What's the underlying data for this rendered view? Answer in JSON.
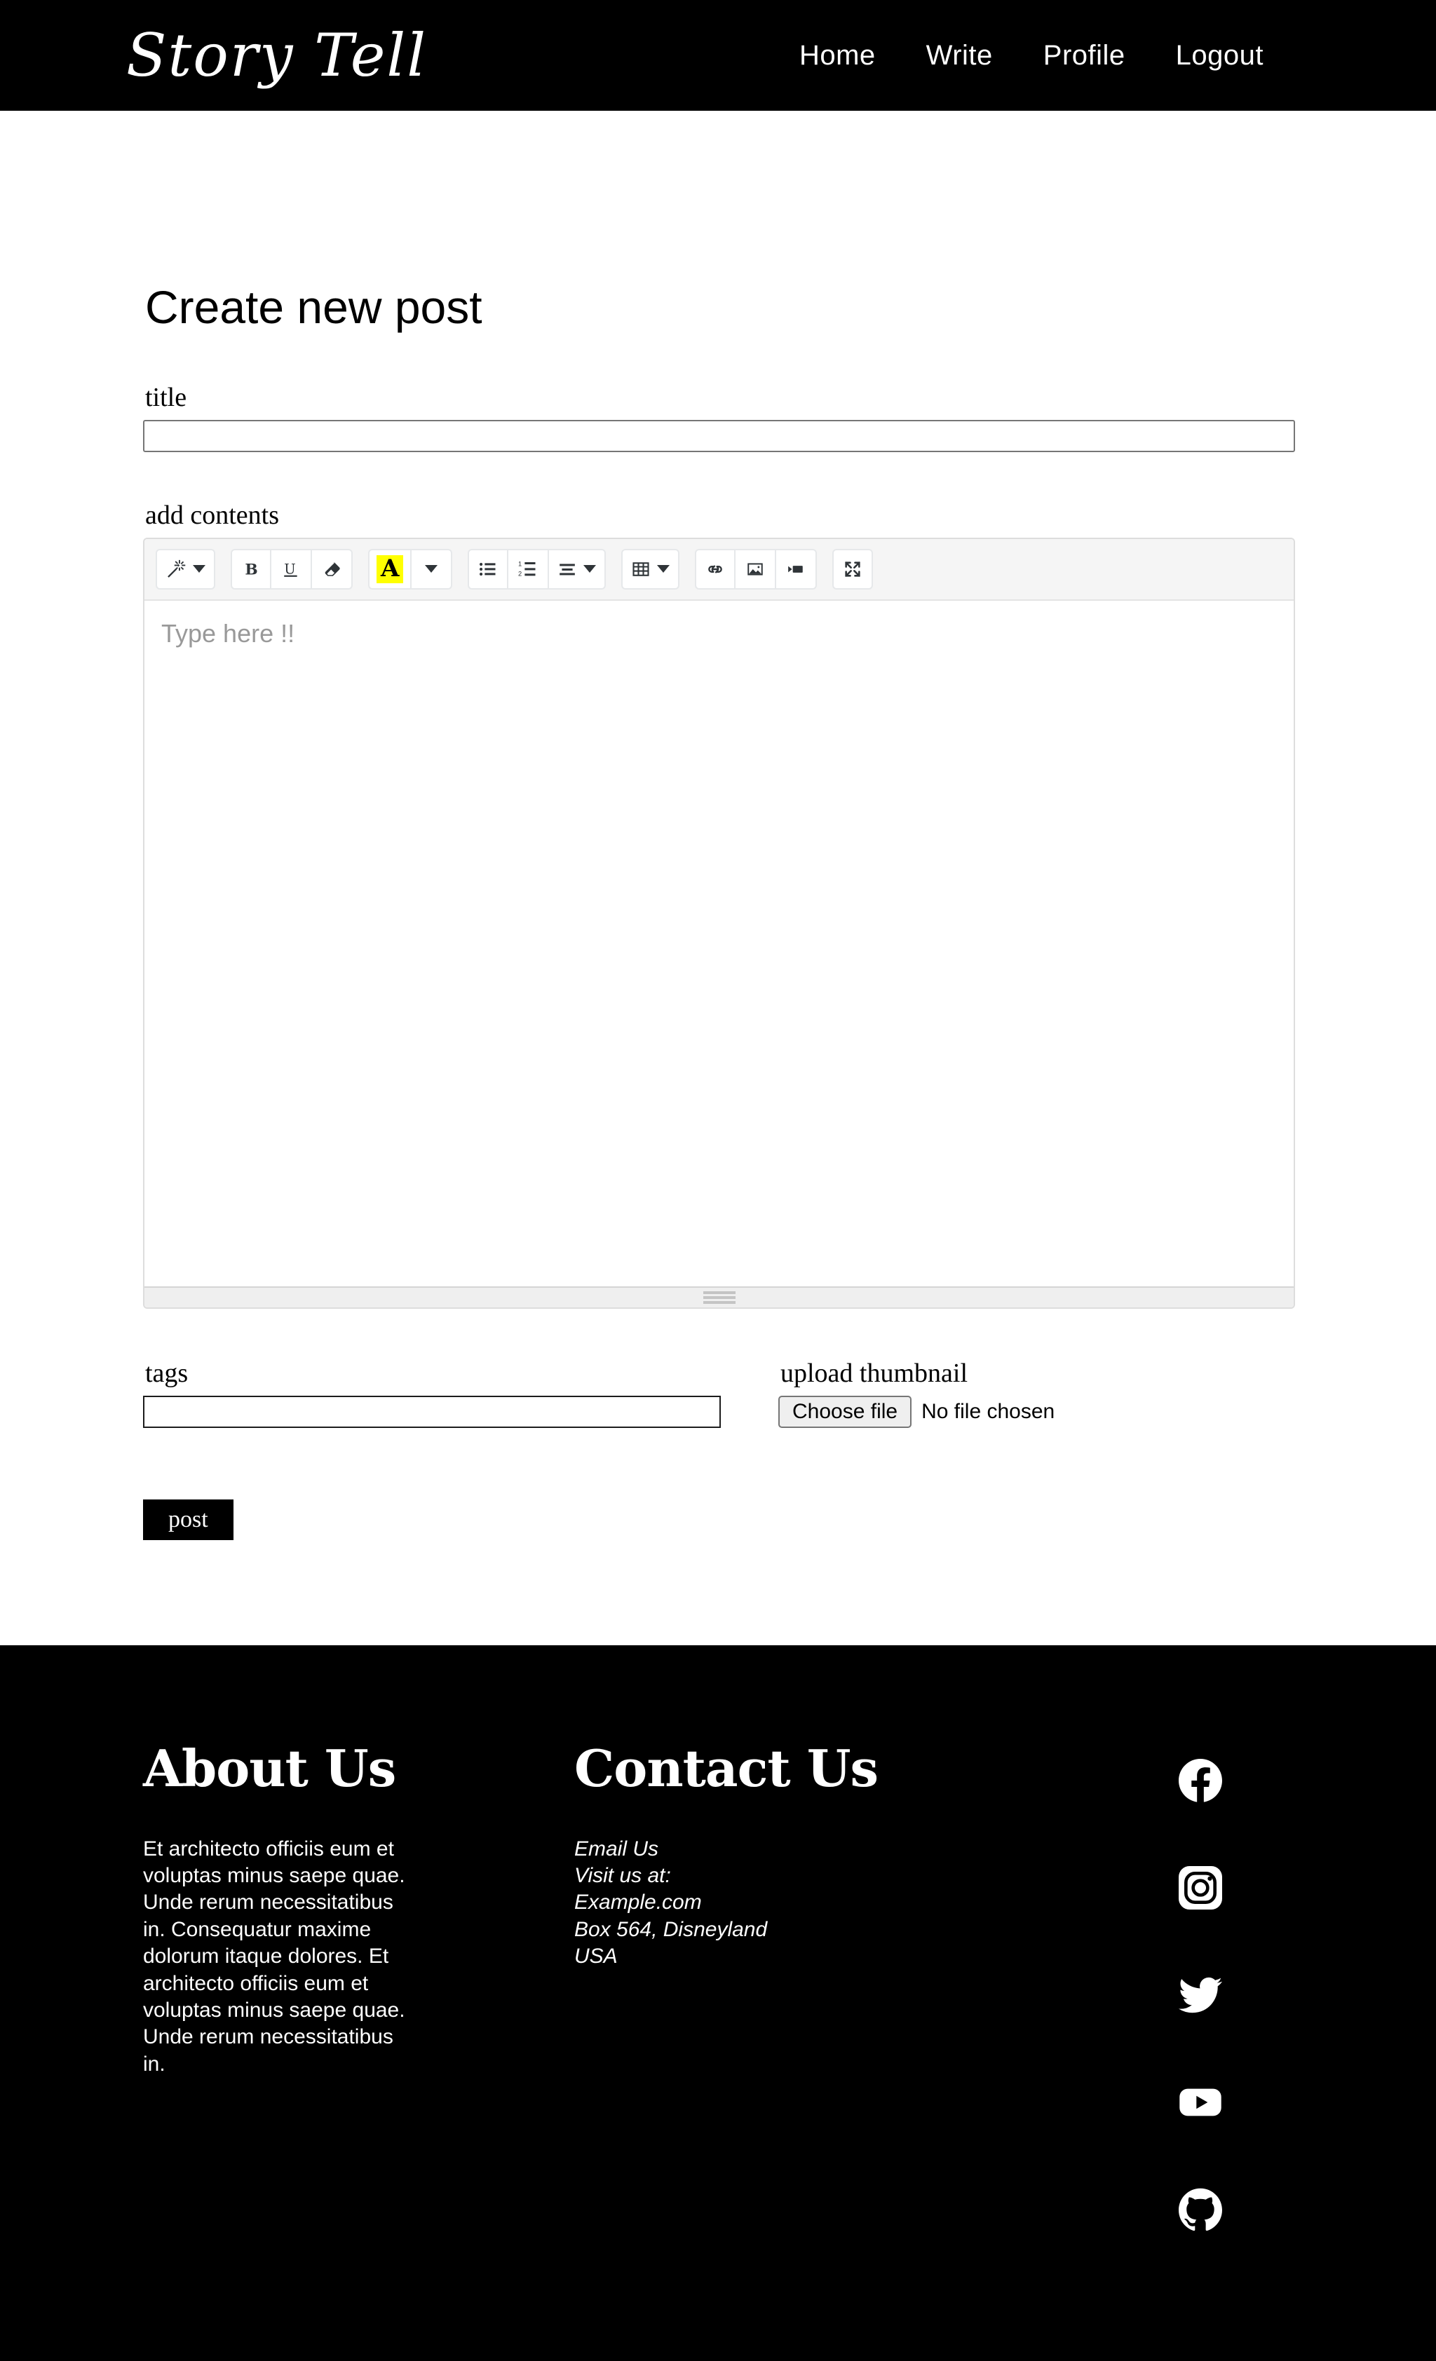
{
  "header": {
    "brand": "Story Tell",
    "nav": [
      {
        "label": "Home",
        "name": "nav-link-home"
      },
      {
        "label": "Write",
        "name": "nav-link-write"
      },
      {
        "label": "Profile",
        "name": "nav-link-profile"
      },
      {
        "label": "Logout",
        "name": "nav-link-logout"
      }
    ]
  },
  "main": {
    "page_title": "Create new post",
    "title_label": "title",
    "title_value": "",
    "title_placeholder": "",
    "contents_label": "add contents",
    "editor_placeholder": "Type here !!",
    "tags_label": "tags",
    "tags_value": "",
    "upload_label": "upload thumbnail",
    "choose_file_label": "Choose file",
    "file_status": "No file chosen",
    "post_button": "post"
  },
  "editor_toolbar": {
    "groups": [
      {
        "buttons": [
          {
            "icon": "magic-wand-icon",
            "caret": true
          }
        ]
      },
      {
        "buttons": [
          {
            "icon": "bold-icon",
            "caret": false
          },
          {
            "icon": "underline-icon",
            "caret": false
          },
          {
            "icon": "eraser-icon",
            "caret": false
          }
        ]
      },
      {
        "buttons": [
          {
            "icon": "font-color-icon",
            "caret": true,
            "glyph": "A",
            "highlight": "#ffff00"
          }
        ]
      },
      {
        "buttons": [
          {
            "icon": "bullet-list-icon",
            "caret": false
          },
          {
            "icon": "numbered-list-icon",
            "caret": false
          },
          {
            "icon": "align-icon",
            "caret": true
          }
        ]
      },
      {
        "buttons": [
          {
            "icon": "table-icon",
            "caret": true
          }
        ]
      },
      {
        "buttons": [
          {
            "icon": "link-icon",
            "caret": false
          },
          {
            "icon": "image-icon",
            "caret": false
          },
          {
            "icon": "video-icon",
            "caret": false
          }
        ]
      },
      {
        "buttons": [
          {
            "icon": "fullscreen-icon",
            "caret": false
          }
        ]
      }
    ]
  },
  "footer": {
    "about_heading": "About Us",
    "about_text": "Et architecto officiis eum et voluptas minus saepe quae. Unde rerum necessitatibus in. Consequatur maxime dolorum itaque dolores. Et architecto officiis eum et voluptas minus saepe quae. Unde rerum necessitatibus in.",
    "contact_heading": "Contact Us",
    "contact_lines": [
      "Email Us",
      "Visit us at:",
      "Example.com",
      "Box 564, Disneyland",
      "USA"
    ],
    "contact_text": "Email Us\nVisit us at:\nExample.com\nBox 564, Disneyland\nUSA",
    "social": [
      {
        "name": "facebook-icon",
        "label": "Facebook"
      },
      {
        "name": "instagram-icon",
        "label": "Instagram"
      },
      {
        "name": "twitter-icon",
        "label": "Twitter"
      },
      {
        "name": "youtube-icon",
        "label": "YouTube"
      },
      {
        "name": "github-icon",
        "label": "GitHub"
      }
    ]
  },
  "colors": {
    "brand_bg": "#000000",
    "page_bg": "#ffffff",
    "text": "#000000",
    "highlight": "#ffff00",
    "toolbar_bg": "#f5f5f5",
    "placeholder": "#999999"
  }
}
